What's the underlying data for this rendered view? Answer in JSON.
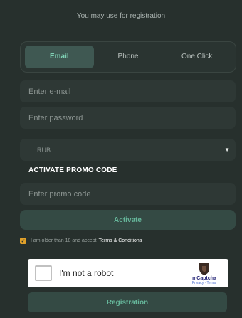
{
  "form": {
    "subtitle": "You may use for registration",
    "tabs": [
      {
        "label": "Email"
      },
      {
        "label": "Phone"
      },
      {
        "label": "One Click"
      }
    ],
    "email_placeholder": "Enter e-mail",
    "password_placeholder": "Enter password",
    "currency": "RUB",
    "promo_title": "ACTIVATE PROMO CODE",
    "promo_placeholder": "Enter promo code",
    "activate_label": "Activate",
    "agree_text": "I am older than 18 and accept",
    "terms_link": "Terms & Conditions",
    "captcha_label": "I'm not a robot",
    "captcha_brand": "mCaptcha",
    "captcha_links": "Privacy · Terms",
    "register_label": "Registration"
  },
  "colors": {
    "background": "#27302d",
    "accent": "#66b79b",
    "checkbox": "#e0a12a"
  }
}
